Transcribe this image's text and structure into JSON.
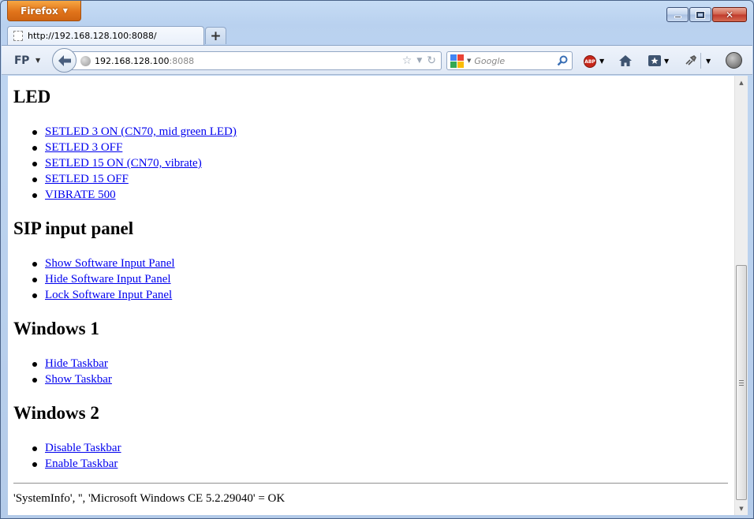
{
  "browser": {
    "app_button": "Firefox",
    "tab_title": "http://192.168.128.100:8088/",
    "new_tab": "+",
    "toolbar_label": "FP",
    "url_host": "192.168.128.100",
    "url_port": ":8088",
    "search_placeholder": "Google",
    "abp_label": "ABP"
  },
  "page": {
    "sections": [
      {
        "heading": "LED",
        "links": [
          "SETLED 3 ON (CN70, mid green LED)",
          "SETLED 3 OFF",
          "SETLED 15 ON (CN70, vibrate)",
          "SETLED 15 OFF",
          "VIBRATE 500"
        ]
      },
      {
        "heading": "SIP input panel",
        "links": [
          "Show Software Input Panel",
          "Hide Software Input Panel",
          "Lock Software Input Panel"
        ]
      },
      {
        "heading": "Windows 1",
        "links": [
          "Hide Taskbar",
          "Show Taskbar"
        ]
      },
      {
        "heading": "Windows 2",
        "links": [
          "Disable Taskbar",
          "Enable Taskbar"
        ]
      }
    ],
    "status": "'SystemInfo', '', 'Microsoft Windows CE 5.2.29040' = OK"
  },
  "colors": {
    "link": "#0000ee",
    "firefox_orange": "#e1741b",
    "close_red": "#c0392b"
  },
  "icons": [
    "chevron-down-icon",
    "minimize-icon",
    "maximize-icon",
    "close-icon",
    "page-icon",
    "back-arrow-icon",
    "globe-icon",
    "star-icon",
    "reload-icon",
    "google-icon",
    "search-icon",
    "adblock-icon",
    "home-icon",
    "bookmarks-icon",
    "extension-icon",
    "addon-icon",
    "scroll-up-icon",
    "scroll-down-icon"
  ]
}
